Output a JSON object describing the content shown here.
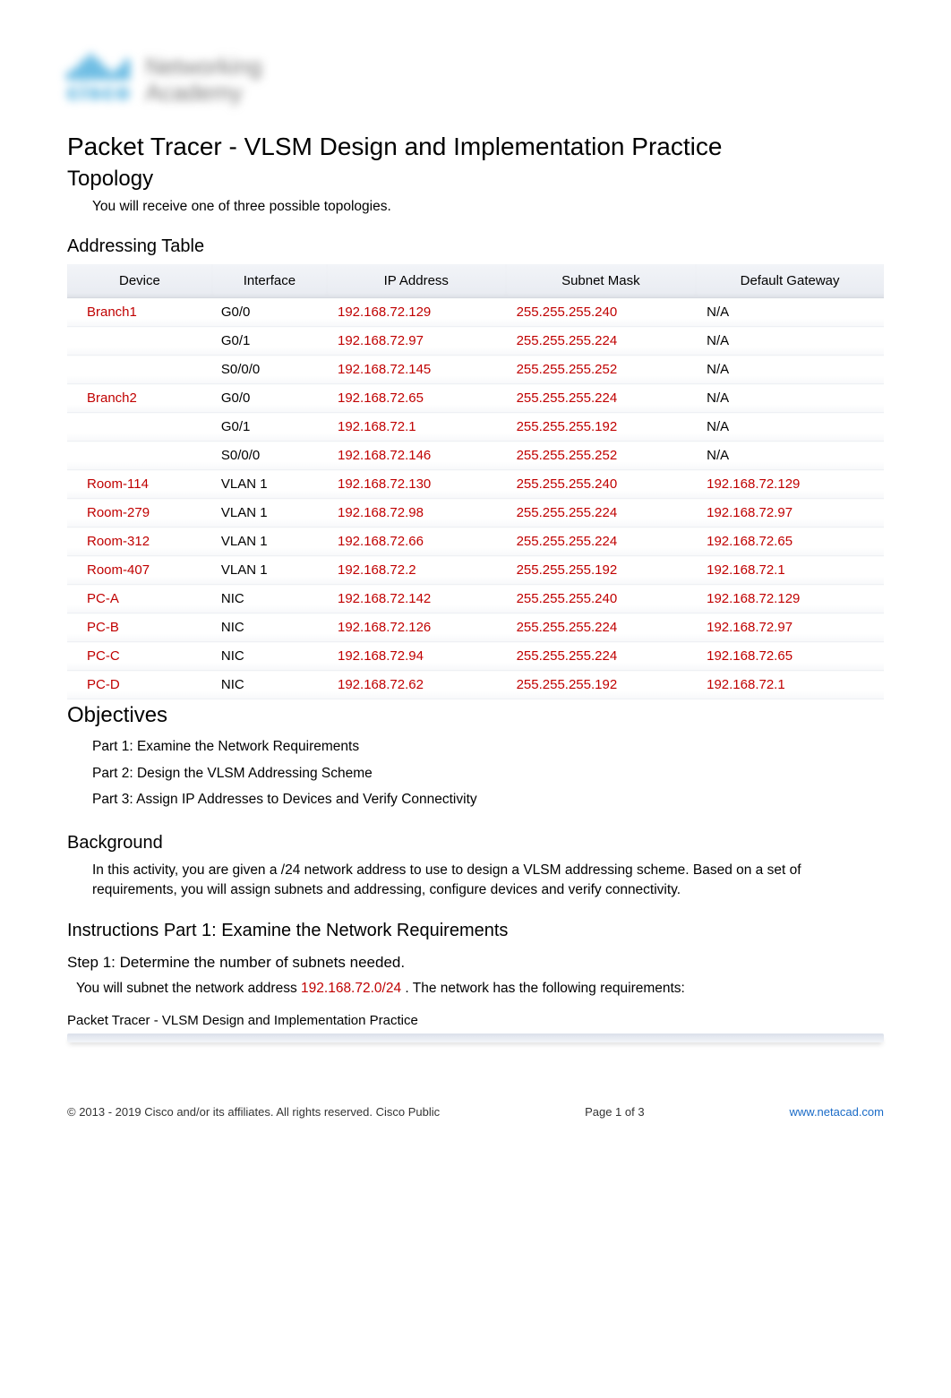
{
  "header": {
    "brand_line1": "Networking",
    "brand_line2": "Academy",
    "cisco": "cisco"
  },
  "doc_title": "Packet Tracer - VLSM Design and Implementation Practice",
  "topology": {
    "heading": "Topology",
    "text": "You will receive one of three possible topologies."
  },
  "addressing": {
    "heading": "Addressing Table",
    "headers": {
      "device": "Device",
      "interface": "Interface",
      "ip": "IP Address",
      "mask": "Subnet Mask",
      "gateway": "Default Gateway"
    },
    "rows": [
      {
        "device": "Branch1",
        "device_red": true,
        "iface": "G0/0",
        "ip": "192.168.72.129",
        "mask": "255.255.255.240",
        "gw": "N/A",
        "gw_red": false
      },
      {
        "device": "",
        "device_red": false,
        "iface": "G0/1",
        "ip": "192.168.72.97",
        "mask": "255.255.255.224",
        "gw": "N/A",
        "gw_red": false
      },
      {
        "device": "",
        "device_red": false,
        "iface": "S0/0/0",
        "ip": "192.168.72.145",
        "mask": "255.255.255.252",
        "gw": "N/A",
        "gw_red": false
      },
      {
        "device": "Branch2",
        "device_red": true,
        "iface": "G0/0",
        "ip": "192.168.72.65",
        "mask": "255.255.255.224",
        "gw": "N/A",
        "gw_red": false
      },
      {
        "device": "",
        "device_red": false,
        "iface": "G0/1",
        "ip": "192.168.72.1",
        "mask": "255.255.255.192",
        "gw": "N/A",
        "gw_red": false
      },
      {
        "device": "",
        "device_red": false,
        "iface": "S0/0/0",
        "ip": "192.168.72.146",
        "mask": "255.255.255.252",
        "gw": "N/A",
        "gw_red": false
      },
      {
        "device": "Room-114",
        "device_red": true,
        "iface": "VLAN 1",
        "ip": "192.168.72.130",
        "mask": "255.255.255.240",
        "gw": "192.168.72.129",
        "gw_red": true
      },
      {
        "device": "Room-279",
        "device_red": true,
        "iface": "VLAN 1",
        "ip": "192.168.72.98",
        "mask": "255.255.255.224",
        "gw": "192.168.72.97",
        "gw_red": true
      },
      {
        "device": "Room-312",
        "device_red": true,
        "iface": "VLAN 1",
        "ip": "192.168.72.66",
        "mask": "255.255.255.224",
        "gw": "192.168.72.65",
        "gw_red": true
      },
      {
        "device": "Room-407",
        "device_red": true,
        "iface": "VLAN 1",
        "ip": "192.168.72.2",
        "mask": "255.255.255.192",
        "gw": "192.168.72.1",
        "gw_red": true
      },
      {
        "device": "PC-A",
        "device_red": true,
        "iface": "NIC",
        "ip": "192.168.72.142",
        "mask": "255.255.255.240",
        "gw": "192.168.72.129",
        "gw_red": true
      },
      {
        "device": "PC-B",
        "device_red": true,
        "iface": "NIC",
        "ip": "192.168.72.126",
        "mask": "255.255.255.224",
        "gw": "192.168.72.97",
        "gw_red": true
      },
      {
        "device": "PC-C",
        "device_red": true,
        "iface": "NIC",
        "ip": "192.168.72.94",
        "mask": "255.255.255.224",
        "gw": "192.168.72.65",
        "gw_red": true
      },
      {
        "device": "PC-D",
        "device_red": true,
        "iface": "NIC",
        "ip": "192.168.72.62",
        "mask": "255.255.255.192",
        "gw": "192.168.72.1",
        "gw_red": true
      }
    ]
  },
  "objectives": {
    "heading": "Objectives",
    "items": [
      "Part 1: Examine the Network Requirements",
      "Part 2: Design the VLSM Addressing Scheme",
      "Part 3: Assign IP Addresses to Devices and Verify Connectivity"
    ]
  },
  "background": {
    "heading": "Background",
    "text": "In this activity, you are given a /24 network address to use to design a VLSM addressing scheme. Based on a set of requirements, you will assign subnets and addressing, configure devices and verify connectivity."
  },
  "instructions": {
    "heading": "Instructions Part 1: Examine the Network Requirements",
    "step1_heading": "Step 1: Determine the number of subnets needed.",
    "step1_pre": "You will subnet the network address ",
    "step1_net": "192.168.72.0/24",
    "step1_post": " . The network has the following requirements:"
  },
  "running_title": "Packet Tracer - VLSM Design and Implementation Practice",
  "footer": {
    "left": "©  2013 - 2019 Cisco and/or its affiliates. All rights reserved. Cisco Public",
    "center_pre": "Page  ",
    "center_page": "1",
    "center_mid": " of ",
    "center_total": "3",
    "right": "www.netacad.com"
  }
}
